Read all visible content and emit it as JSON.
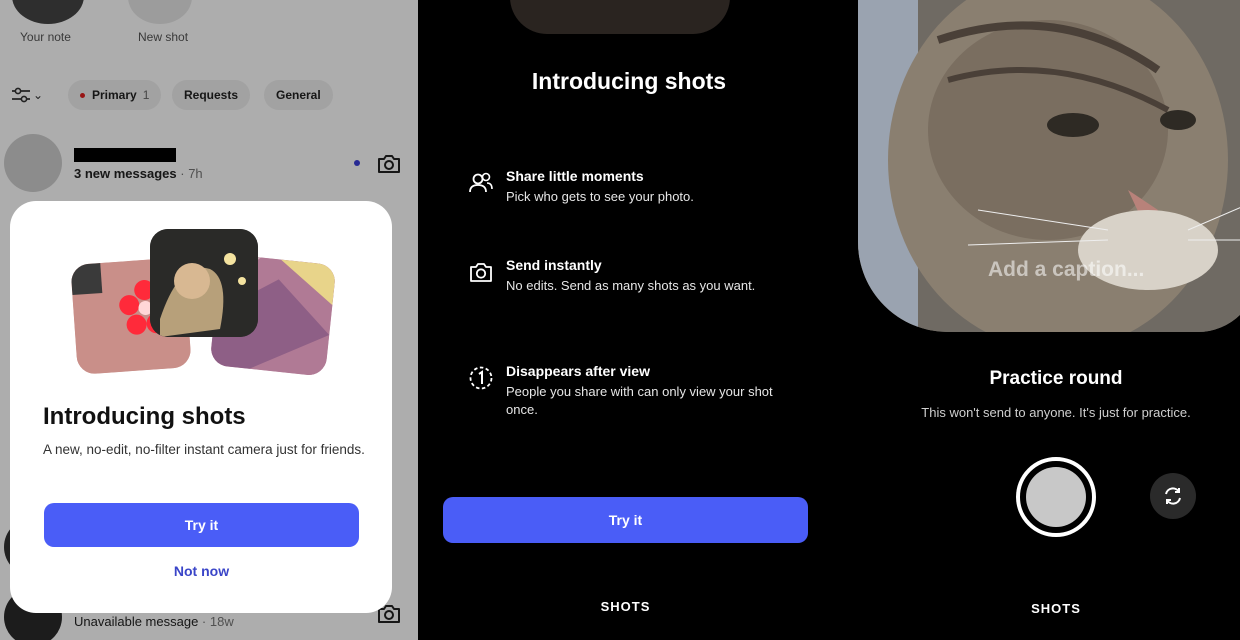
{
  "inbox": {
    "notes": [
      {
        "label": "Your note"
      },
      {
        "label": "New shot"
      }
    ],
    "tabs": [
      {
        "label": "Primary",
        "count": "1"
      },
      {
        "label": "Requests"
      },
      {
        "label": "General"
      }
    ],
    "first_row": {
      "summary": "3 new messages",
      "time": "· 7h"
    },
    "last_row": {
      "summary": "Unavailable message",
      "time": "· 18w"
    }
  },
  "intro_modal": {
    "title": "Introducing shots",
    "description": "A new, no-edit, no-filter instant camera just for friends.",
    "primary_button": "Try it",
    "secondary_button": "Not now"
  },
  "intro_screen": {
    "title": "Introducing shots",
    "features": [
      {
        "icon": "people-icon",
        "title": "Share little moments",
        "description": "Pick who gets to see your photo."
      },
      {
        "icon": "camera-icon",
        "title": "Send instantly",
        "description": "No edits. Send as many shots as you want."
      },
      {
        "icon": "one-view-icon",
        "title": "Disappears after view",
        "description": "People you share with can only view your shot once."
      }
    ],
    "button": "Try it",
    "footer": "SHOTS"
  },
  "camera_screen": {
    "caption_placeholder": "Add a caption...",
    "title": "Practice round",
    "subtitle": "This won't send to anyone. It's just for practice.",
    "footer": "SHOTS"
  },
  "colors": {
    "accent": "#4a5df7",
    "link": "#3a45c8",
    "unread": "#3a3fd9"
  }
}
